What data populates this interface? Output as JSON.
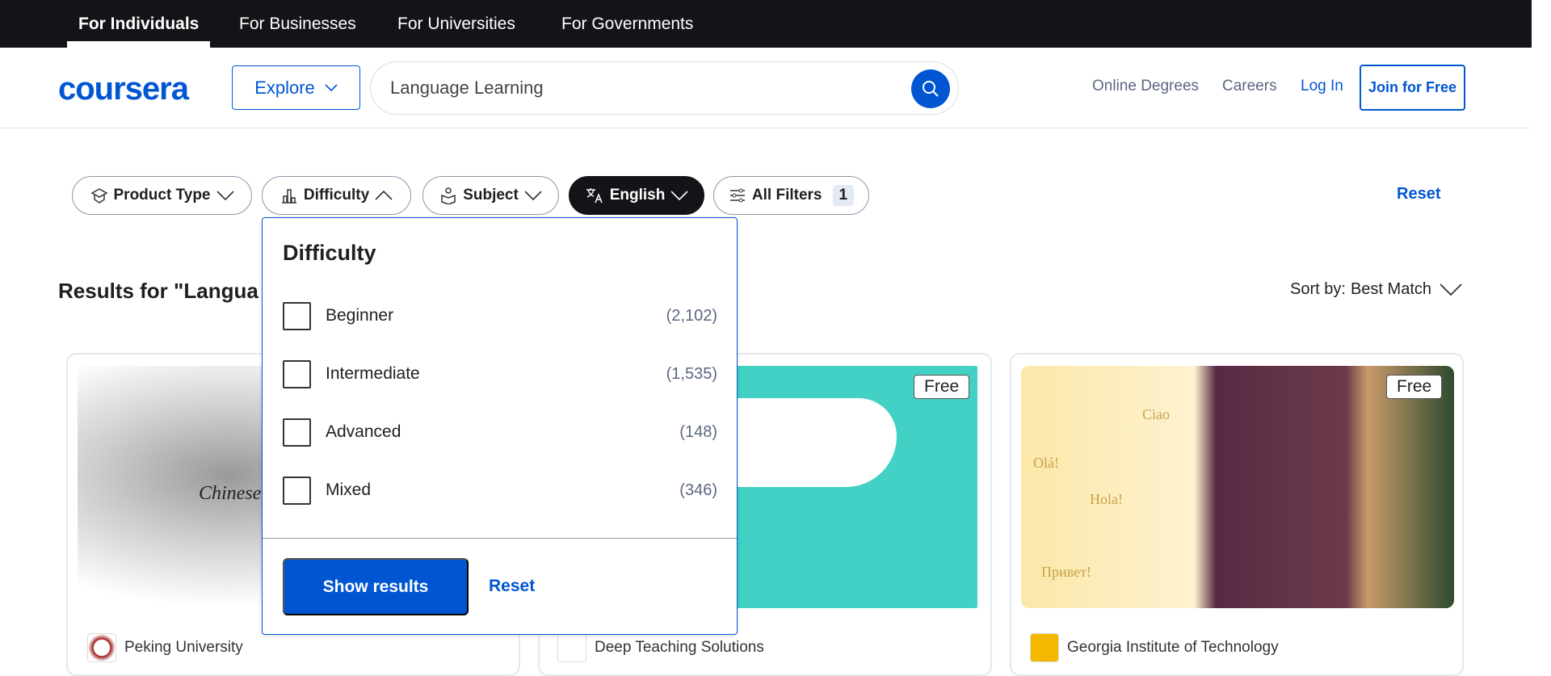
{
  "topnav": {
    "items": [
      "For Individuals",
      "For Businesses",
      "For Universities",
      "For Governments"
    ]
  },
  "header": {
    "logo": "coursera",
    "explore": "Explore",
    "search_value": "Language Learning",
    "links": {
      "online_degrees": "Online Degrees",
      "careers": "Careers",
      "login": "Log In",
      "join": "Join for Free"
    }
  },
  "filters": {
    "product_type": "Product Type",
    "difficulty": "Difficulty",
    "subject": "Subject",
    "language": "English",
    "all_filters": "All Filters",
    "all_filters_count": "1",
    "reset": "Reset"
  },
  "results": {
    "heading": "Results for \"Langua",
    "sort_label": "Sort by:",
    "sort_value": "Best Match"
  },
  "dropdown": {
    "title": "Difficulty",
    "options": [
      {
        "label": "Beginner",
        "count": "(2,102)"
      },
      {
        "label": "Intermediate",
        "count": "(1,535)"
      },
      {
        "label": "Advanced",
        "count": "(148)"
      },
      {
        "label": "Mixed",
        "count": "(346)"
      }
    ],
    "show_results": "Show results",
    "reset": "Reset"
  },
  "cards": [
    {
      "partner": "Peking University",
      "image_text": "Chinese"
    },
    {
      "partner": "Deep Teaching Solutions",
      "badge": "Free"
    },
    {
      "partner": "Georgia Institute of Technology",
      "badge": "Free",
      "image_words": [
        "Olá!",
        "Ciao",
        "Hola!",
        "Привет!"
      ]
    }
  ],
  "colors": {
    "brand": "#0056d2",
    "topbar": "#131417"
  }
}
